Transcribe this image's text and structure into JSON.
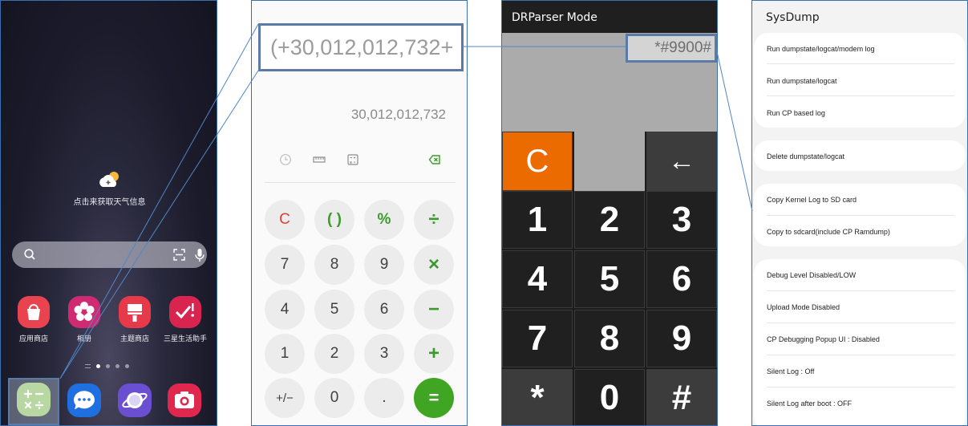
{
  "home": {
    "weather_text": "点击来获取天气信息",
    "apps": [
      {
        "label": "应用商店",
        "icon": "galaxy-store-icon",
        "color": "#e8434e"
      },
      {
        "label": "相册",
        "icon": "gallery-flower-icon",
        "color": "#d02a72"
      },
      {
        "label": "主题商店",
        "icon": "theme-store-icon",
        "color": "#e63a4a"
      },
      {
        "label": "三星生活助手",
        "icon": "samsung-free-icon",
        "color": "#d8244f"
      }
    ],
    "dock": [
      {
        "icon": "calculator-icon",
        "color": "#b9d7a3"
      },
      {
        "icon": "messages-icon",
        "color": "#1f6fe0"
      },
      {
        "icon": "internet-icon",
        "color": "#6a4fd0"
      },
      {
        "icon": "camera-icon",
        "color": "#e0284e"
      }
    ]
  },
  "calculator": {
    "expression": "(+30,012,012,732+",
    "result": "30,012,012,732",
    "keys": [
      [
        "C",
        "( )",
        "%",
        "÷"
      ],
      [
        "7",
        "8",
        "9",
        "×"
      ],
      [
        "4",
        "5",
        "6",
        "−"
      ],
      [
        "1",
        "2",
        "3",
        "+"
      ],
      [
        "+/−",
        "0",
        ".",
        "="
      ]
    ]
  },
  "drparser": {
    "title": "DRParser Mode",
    "code": "*#9900#",
    "keys": [
      [
        "C",
        "",
        "←"
      ],
      [
        "1",
        "2",
        "3"
      ],
      [
        "4",
        "5",
        "6"
      ],
      [
        "7",
        "8",
        "9"
      ],
      [
        "*",
        "0",
        "#"
      ]
    ]
  },
  "sysdump": {
    "title": "SysDump",
    "groups": [
      [
        "Run dumpstate/logcat/modem log",
        "Run dumpstate/logcat",
        "Run CP based log"
      ],
      [
        "Delete dumpstate/logcat"
      ],
      [
        "Copy Kernel Log to SD card",
        "Copy to sdcard(include CP Ramdump)"
      ],
      [
        "Debug Level Disabled/LOW",
        "Upload Mode Disabled",
        "CP Debugging Popup UI : Disabled",
        "Silent Log : Off",
        "Silent Log after boot : OFF"
      ]
    ]
  }
}
